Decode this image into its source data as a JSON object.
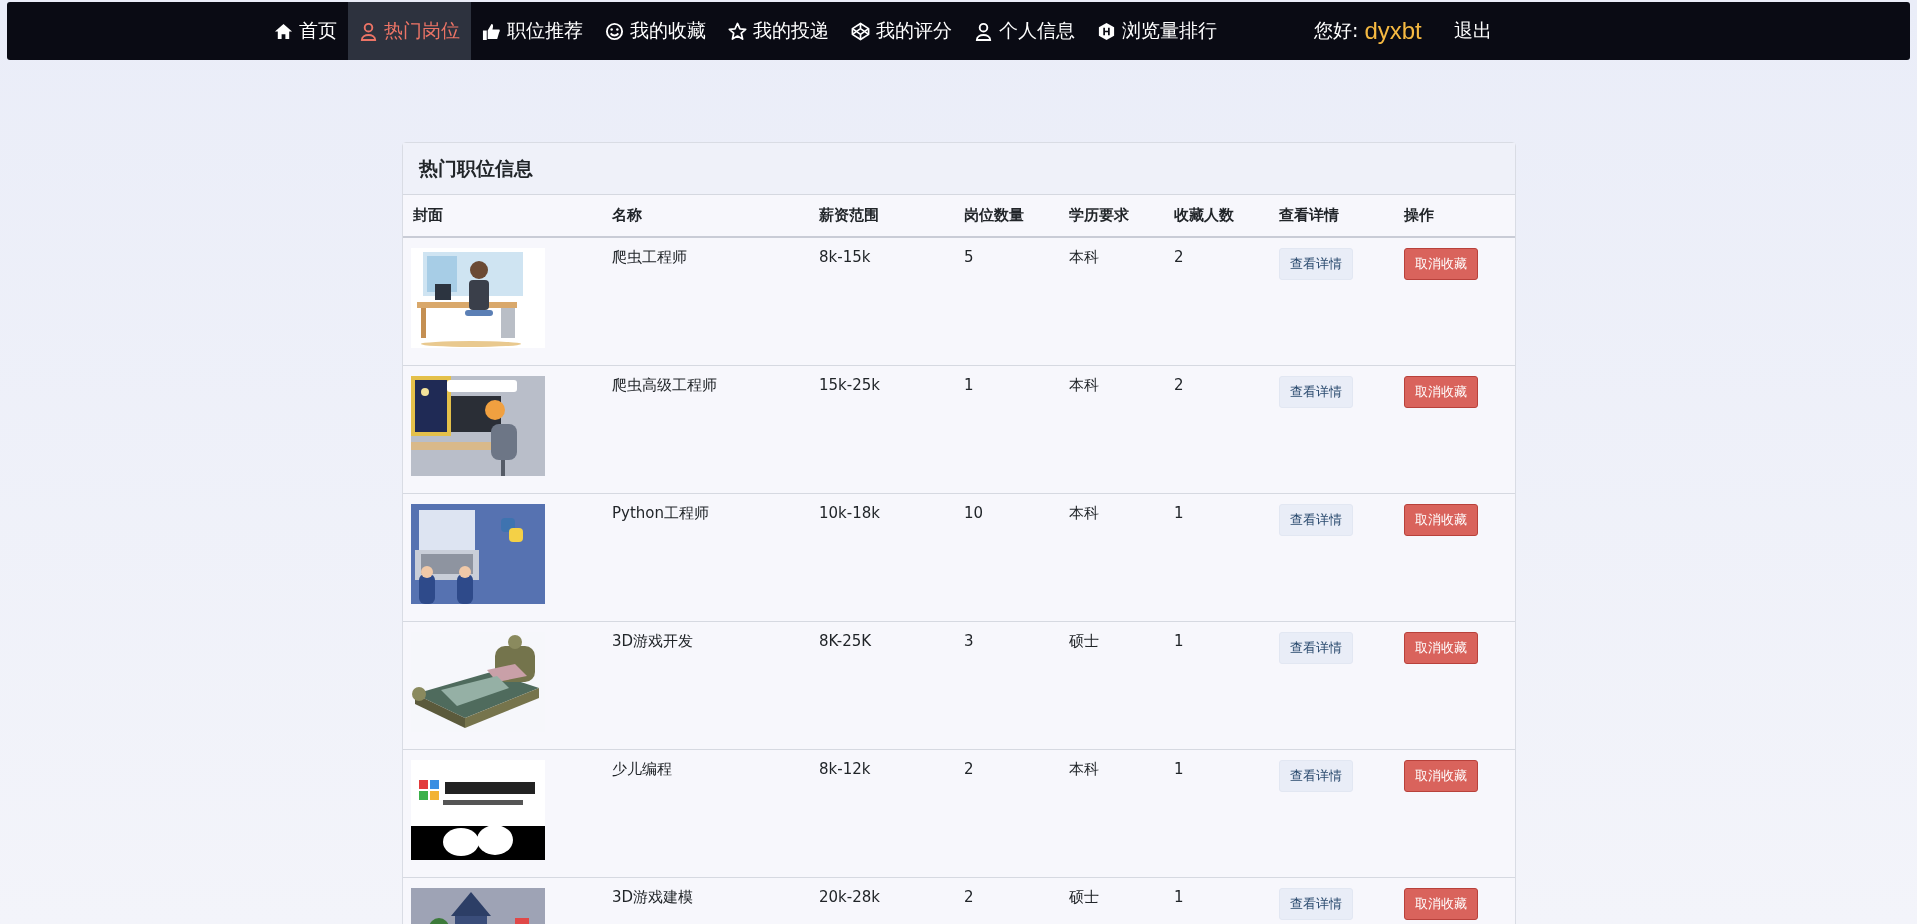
{
  "nav": {
    "items": [
      {
        "label": "首页",
        "selected": false
      },
      {
        "label": "热门岗位",
        "selected": true
      },
      {
        "label": "职位推荐",
        "selected": false
      },
      {
        "label": "我的收藏",
        "selected": false
      },
      {
        "label": "我的投递",
        "selected": false
      },
      {
        "label": "我的评分",
        "selected": false
      },
      {
        "label": "个人信息",
        "selected": false
      },
      {
        "label": "浏览量排行",
        "selected": false
      }
    ],
    "greeting": "您好:",
    "username": "dyxbt",
    "logout": "退出"
  },
  "card": {
    "title": "热门职位信息",
    "table": {
      "columns": [
        "封面",
        "名称",
        "薪资范围",
        "岗位数量",
        "学历要求",
        "收藏人数",
        "查看详情",
        "操作"
      ],
      "rows": [
        {
          "name": "爬虫工程师",
          "salary": "8k-15k",
          "count": "5",
          "education": "本科",
          "favorites": "2",
          "detail": "查看详情",
          "action": "取消收藏"
        },
        {
          "name": "爬虫高级工程师",
          "salary": "15k-25k",
          "count": "1",
          "education": "本科",
          "favorites": "2",
          "detail": "查看详情",
          "action": "取消收藏"
        },
        {
          "name": "Python工程师",
          "salary": "10k-18k",
          "count": "10",
          "education": "本科",
          "favorites": "1",
          "detail": "查看详情",
          "action": "取消收藏"
        },
        {
          "name": "3D游戏开发",
          "salary": "8K-25K",
          "count": "3",
          "education": "硕士",
          "favorites": "1",
          "detail": "查看详情",
          "action": "取消收藏"
        },
        {
          "name": "少儿编程",
          "salary": "8k-12k",
          "count": "2",
          "education": "本科",
          "favorites": "1",
          "detail": "查看详情",
          "action": "取消收藏"
        },
        {
          "name": "3D游戏建模",
          "salary": "20k-28k",
          "count": "2",
          "education": "硕士",
          "favorites": "1",
          "detail": "查看详情",
          "action": "取消收藏"
        }
      ]
    }
  }
}
